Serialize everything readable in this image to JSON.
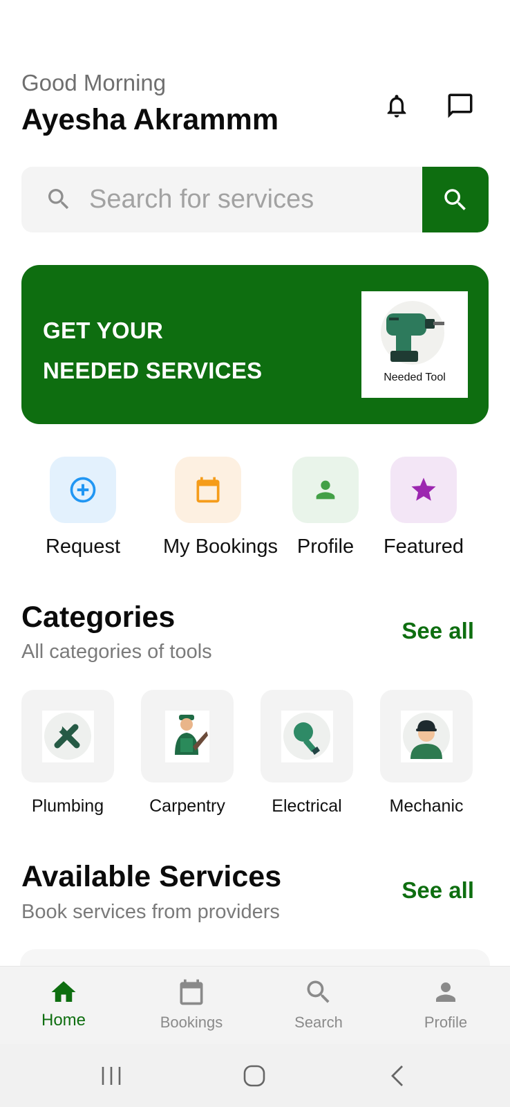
{
  "header": {
    "greeting": "Good Morning",
    "username": "Ayesha Akrammm"
  },
  "search": {
    "placeholder": "Search for services"
  },
  "banner": {
    "line1": "GET YOUR",
    "line2": "NEEDED SERVICES",
    "image_caption": "Needed Tool"
  },
  "quick_actions": [
    {
      "label": "Request",
      "icon": "add-circle-icon",
      "color": "#2196f3",
      "bg": "#e3f1fd"
    },
    {
      "label": "My Bookings",
      "icon": "calendar-icon",
      "color": "#f59c1a",
      "bg": "#fdf0e1"
    },
    {
      "label": "Profile",
      "icon": "person-icon",
      "color": "#43a047",
      "bg": "#e9f4ea"
    },
    {
      "label": "Featured",
      "icon": "star-icon",
      "color": "#9c27b0",
      "bg": "#f3e6f6"
    }
  ],
  "categories": {
    "title": "Categories",
    "subtitle": "All categories of tools",
    "see_all": "See all",
    "items": [
      {
        "label": "Plumbing",
        "icon": "wrench-screwdriver-icon"
      },
      {
        "label": "Carpentry",
        "icon": "carpenter-icon"
      },
      {
        "label": "Electrical",
        "icon": "lightbulb-icon"
      },
      {
        "label": "Mechanic",
        "icon": "mechanic-icon"
      }
    ]
  },
  "services": {
    "title": "Available Services",
    "subtitle": "Book services from providers",
    "see_all": "See all"
  },
  "bottom_nav": [
    {
      "label": "Home",
      "icon": "home-icon",
      "active": true
    },
    {
      "label": "Bookings",
      "icon": "calendar-icon",
      "active": false
    },
    {
      "label": "Search",
      "icon": "search-icon",
      "active": false
    },
    {
      "label": "Profile",
      "icon": "person-icon",
      "active": false
    }
  ],
  "colors": {
    "brand": "#0e6e10",
    "muted_text": "#7a7a7a",
    "tile_bg": "#f3f3f3"
  }
}
